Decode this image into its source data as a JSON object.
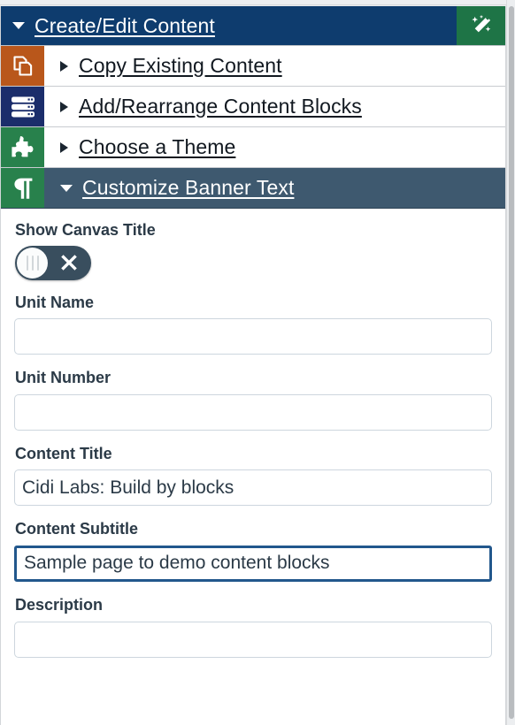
{
  "accordion": {
    "header": {
      "label": "Create/Edit Content",
      "caret_icon": "caret-down-icon",
      "action_icon": "magic-wand-icon",
      "bg_color": "#0e3c6e",
      "action_bg_color": "#1e7446"
    },
    "items": [
      {
        "label": "Copy Existing Content",
        "icon": "copy-pages-icon",
        "tile_color": "#b9571b",
        "caret_icon": "caret-right-icon",
        "expanded": false
      },
      {
        "label": "Add/Rearrange Content Blocks",
        "icon": "content-blocks-icon",
        "tile_color": "#1b2d6b",
        "caret_icon": "caret-right-icon",
        "expanded": false
      },
      {
        "label": "Choose a Theme",
        "icon": "puzzle-piece-icon",
        "tile_color": "#28814c",
        "caret_icon": "caret-right-icon",
        "expanded": false
      },
      {
        "label": "Customize Banner Text",
        "icon": "pilcrow-icon",
        "tile_color": "#28814c",
        "caret_icon": "caret-down-icon",
        "expanded": true,
        "active_bg_color": "#3e596f"
      }
    ]
  },
  "form": {
    "show_canvas_title": {
      "label": "Show Canvas Title",
      "state": "off",
      "off_icon": "x-icon",
      "track_color": "#394e5e"
    },
    "fields": [
      {
        "label": "Unit Name",
        "value": "",
        "placeholder": "",
        "focused": false
      },
      {
        "label": "Unit Number",
        "value": "",
        "placeholder": "",
        "focused": false
      },
      {
        "label": "Content Title",
        "value": "Cidi Labs: Build by blocks",
        "placeholder": "",
        "focused": false
      },
      {
        "label": "Content Subtitle",
        "value": "Sample page to demo content blocks",
        "placeholder": "",
        "focused": true,
        "focus_color": "#22578c"
      },
      {
        "label": "Description",
        "value": "",
        "placeholder": "",
        "focused": false
      }
    ]
  }
}
